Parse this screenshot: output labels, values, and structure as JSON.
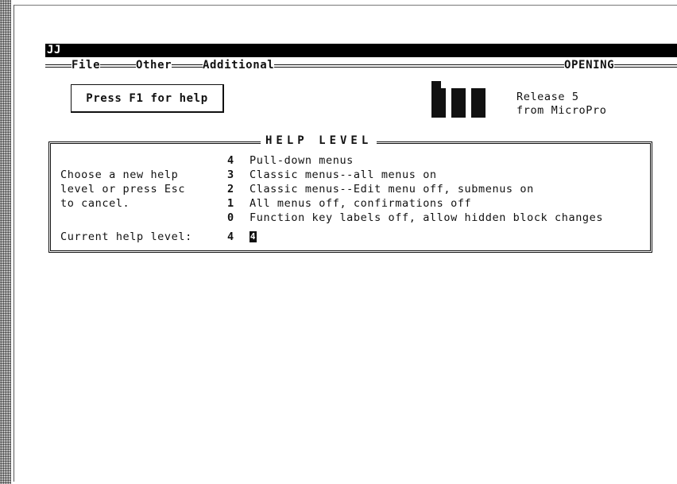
{
  "window": {
    "title": "JJ"
  },
  "menu": {
    "items": [
      "File",
      "Other",
      "Additional"
    ],
    "status": "OPENING"
  },
  "help_hint": {
    "prefix": "Press ",
    "key": "F1",
    "suffix": " for help"
  },
  "release": {
    "line1": "Release 5",
    "line2": "from MicroPro"
  },
  "help_level_dialog": {
    "title": "HELP LEVEL",
    "prompt_lines": [
      "Choose a new help",
      "level or press Esc",
      "to cancel."
    ],
    "options": [
      {
        "level": "4",
        "description": "Pull-down menus"
      },
      {
        "level": "3",
        "description": "Classic menus--all menus on"
      },
      {
        "level": "2",
        "description": "Classic menus--Edit menu off, submenus on"
      },
      {
        "level": "1",
        "description": "All menus off, confirmations off"
      },
      {
        "level": "0",
        "description": "Function key labels off, allow hidden block changes"
      }
    ],
    "current_label": "Current help level:",
    "current_value": "4",
    "input_value": "4"
  },
  "colors": {
    "ink": "#111111",
    "background": "#ffffff"
  }
}
